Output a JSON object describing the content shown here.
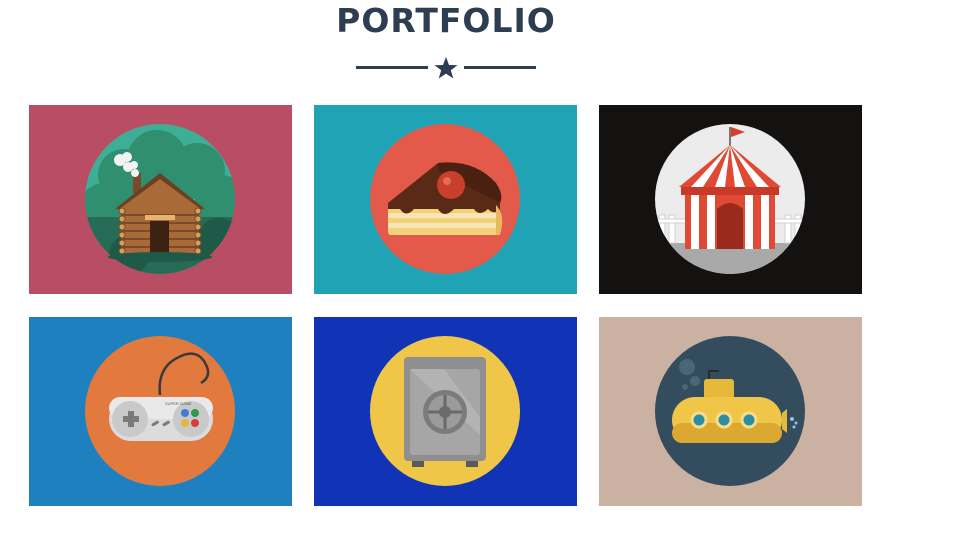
{
  "section": {
    "title": "PORTFOLIO",
    "divider_icon": "star-icon"
  },
  "colors": {
    "title": "#2c3e50",
    "tile_backgrounds": [
      "#b94d64",
      "#21a3b6",
      "#141111",
      "#1f80c0",
      "#1034b5",
      "#cbb1a2"
    ]
  },
  "portfolio": {
    "items": [
      {
        "icon": "log-cabin-icon"
      },
      {
        "icon": "cake-slice-icon"
      },
      {
        "icon": "circus-tent-icon"
      },
      {
        "icon": "game-controller-icon",
        "controller_text": "SUPER GAME"
      },
      {
        "icon": "safe-icon"
      },
      {
        "icon": "submarine-icon"
      }
    ]
  }
}
